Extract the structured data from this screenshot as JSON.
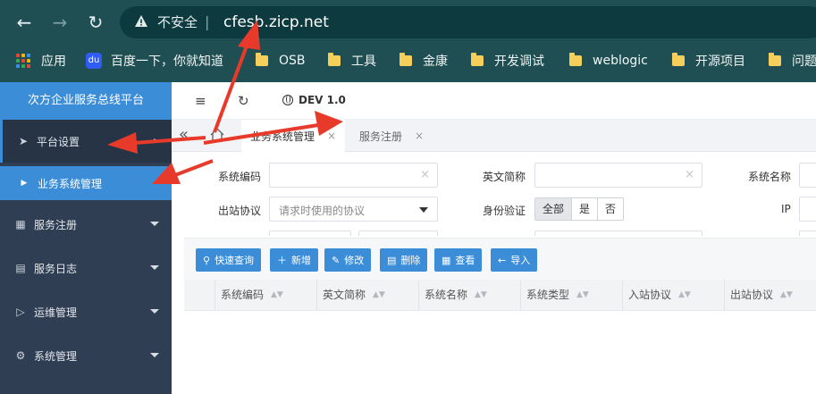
{
  "browser": {
    "insecure_label": "不安全",
    "url": "cfesb.zicp.net",
    "bookmarks": [
      {
        "label": "应用"
      },
      {
        "label": "百度一下，你就知道"
      },
      {
        "label": "OSB"
      },
      {
        "label": "工具"
      },
      {
        "label": "金康"
      },
      {
        "label": "开发调试"
      },
      {
        "label": "weblogic"
      },
      {
        "label": "开源项目"
      },
      {
        "label": "问题"
      }
    ]
  },
  "app": {
    "brand": "次方企业服务总线平台",
    "env_label": "DEV 1.0",
    "menu": [
      {
        "label": "平台设置",
        "icon": "paper-plane-icon"
      },
      {
        "label": "业务系统管理",
        "icon": "triangle-right-icon"
      },
      {
        "label": "服务注册",
        "icon": "cubes-icon"
      },
      {
        "label": "服务日志",
        "icon": "document-icon"
      },
      {
        "label": "运维管理",
        "icon": "play-circle-icon"
      },
      {
        "label": "系统管理",
        "icon": "gear-icon"
      }
    ],
    "tabs": [
      {
        "label": "业务系统管理",
        "active": true
      },
      {
        "label": "服务注册",
        "active": false
      }
    ]
  },
  "form": {
    "sys_code_label": "系统编码",
    "en_abbr_label": "英文简称",
    "sys_name_label": "系统名称",
    "outbound_label": "出站协议",
    "outbound_placeholder": "请求时使用的协议",
    "auth_label": "身份验证",
    "auth_options": [
      "全部",
      "是",
      "否"
    ],
    "auth_selected": "全部",
    "ip_label": "IP"
  },
  "toolbar": {
    "buttons": [
      {
        "label": "快速查询",
        "icon": "search-icon"
      },
      {
        "label": "新增",
        "icon": "plus-icon"
      },
      {
        "label": "修改",
        "icon": "pencil-icon"
      },
      {
        "label": "删除",
        "icon": "trash-icon"
      },
      {
        "label": "查看",
        "icon": "view-icon"
      },
      {
        "label": "导入",
        "icon": "arrow-left-icon"
      }
    ]
  },
  "table": {
    "columns": [
      "系统编码",
      "英文简称",
      "系统名称",
      "系统类型",
      "入站协议",
      "出站协议"
    ]
  },
  "colors": {
    "accent": "#3c8dd8",
    "sidebar": "#2f3e53",
    "chrome": "#1f4f53",
    "arrow": "#e83a2a"
  }
}
